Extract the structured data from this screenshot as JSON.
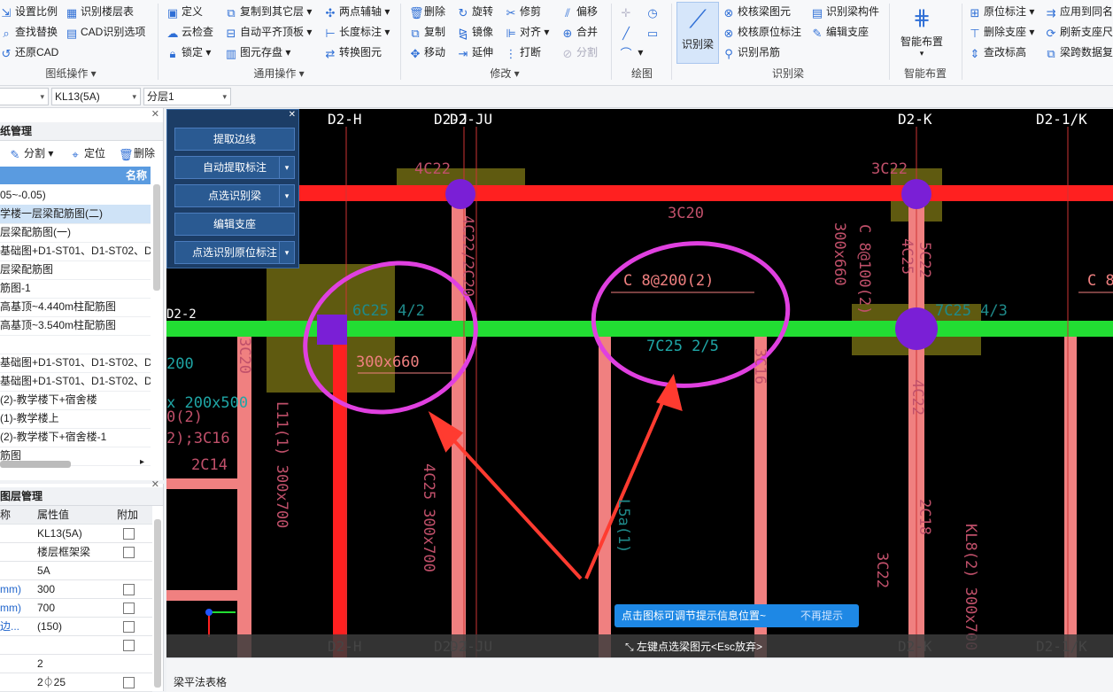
{
  "ribbon": {
    "groups": {
      "drawing_ops": {
        "label": "图纸操作",
        "items": [
          "设置比例",
          "识别楼层表",
          "查找替换",
          "CAD识别选项",
          "还原CAD"
        ]
      },
      "general_ops": {
        "label": "通用操作",
        "items": [
          "定义",
          "复制到其它层",
          "两点辅轴",
          "云检查",
          "自动平齐顶板",
          "长度标注",
          "锁定",
          "图元存盘",
          "转换图元"
        ]
      },
      "modify": {
        "label": "修改",
        "items": [
          "删除",
          "旋转",
          "修剪",
          "偏移",
          "复制",
          "镜像",
          "对齐",
          "合并",
          "移动",
          "延伸",
          "打断",
          "分割"
        ]
      },
      "draw": {
        "label": "绘图"
      },
      "recognize_beam": {
        "label": "识别梁",
        "big_button": "识别梁",
        "items": [
          "校核梁图元",
          "识别梁构件",
          "校核原位标注",
          "编辑支座",
          "识别吊筋"
        ]
      },
      "smart_layout": {
        "label": "智能布置",
        "big_button": "智能布置"
      },
      "extra": {
        "items": [
          "原位标注",
          "应用到同名",
          "删除支座",
          "刷新支座尺",
          "查改标高",
          "梁跨数据复"
        ]
      }
    }
  },
  "selectors": {
    "sel1": "",
    "sel2": "KL13(5A)",
    "sel3": "分层1"
  },
  "drawing_panel": {
    "title": "纸管理",
    "toolbar": {
      "split": "分割",
      "locate": "定位",
      "delete": "删除"
    },
    "col_header": "名称",
    "rows": [
      "05~-0.05)",
      "学楼一层梁配筋图(二)",
      "层梁配筋图(一)",
      "基础图+D1-ST01、D1-ST02、D",
      "层梁配筋图",
      "筋图-1",
      "高基顶~4.440m柱配筋图",
      "高基顶~3.540m柱配筋图",
      "",
      "基础图+D1-ST01、D1-ST02、D",
      "基础图+D1-ST01、D1-ST02、D",
      "(2)-教学楼下+宿舍楼",
      "(1)-教学楼上",
      "(2)-教学楼下+宿舍楼-1",
      "筋图"
    ]
  },
  "prop_panel": {
    "title": "图层管理",
    "headers": [
      "称",
      "属性值",
      "附加"
    ],
    "rows": [
      {
        "name": "",
        "value": "KL13(5A)"
      },
      {
        "name": "",
        "value": "楼层框架梁"
      },
      {
        "name": "",
        "value": "5A"
      },
      {
        "name": "mm)",
        "value": "300"
      },
      {
        "name": "mm)",
        "value": "700"
      },
      {
        "name": "边...",
        "value": "(150)"
      },
      {
        "name": "",
        "value": ""
      },
      {
        "name": "",
        "value": "2"
      },
      {
        "name": "",
        "value": "2⏀25"
      }
    ]
  },
  "float_panel": {
    "buttons": [
      "提取边线",
      "自动提取标注",
      "点选识别梁",
      "编辑支座",
      "点选识别原位标注"
    ]
  },
  "canvas": {
    "axis_top": [
      "D2-H",
      "D2-J",
      "D2-JU",
      "D2-K",
      "D2-1/K"
    ],
    "axis_bottom": [
      "D2-H",
      "D2-J",
      "D2-JU",
      "D2-K",
      "D2-1/K"
    ],
    "axis_left": "D2-2",
    "labels": [
      "4C22",
      "3C22",
      "3C20",
      "C 8@200(2)",
      "7C25 2/5",
      "6C25 4/2",
      "300x660",
      "7C25 4/3",
      "4C22",
      "5C22",
      "4C25",
      "300x660",
      "C 8@100(2)",
      "4C22/2C20",
      "3C20",
      "2C14",
      "L11(1) 300x700",
      "4C25 300x700",
      "KL8(2) 300x700",
      "2C18",
      "3C22",
      "L5a(1)",
      "3C16",
      "200",
      "x 200x500",
      "0(2)",
      "2);3C16",
      "C 8"
    ]
  },
  "tip": {
    "text": "点击图标可调节提示信息位置~",
    "dismiss": "不再提示"
  },
  "status": {
    "text": "左键点选梁图元<Esc放弃>"
  },
  "bottom": {
    "title": "梁平法表格"
  },
  "colors": {
    "highlight": "#e040e0",
    "beam_red": "#ff2020",
    "beam_green": "#22dd33",
    "pink": "#f08080",
    "purple": "#7a1fd6",
    "olive": "#5f5a10"
  }
}
